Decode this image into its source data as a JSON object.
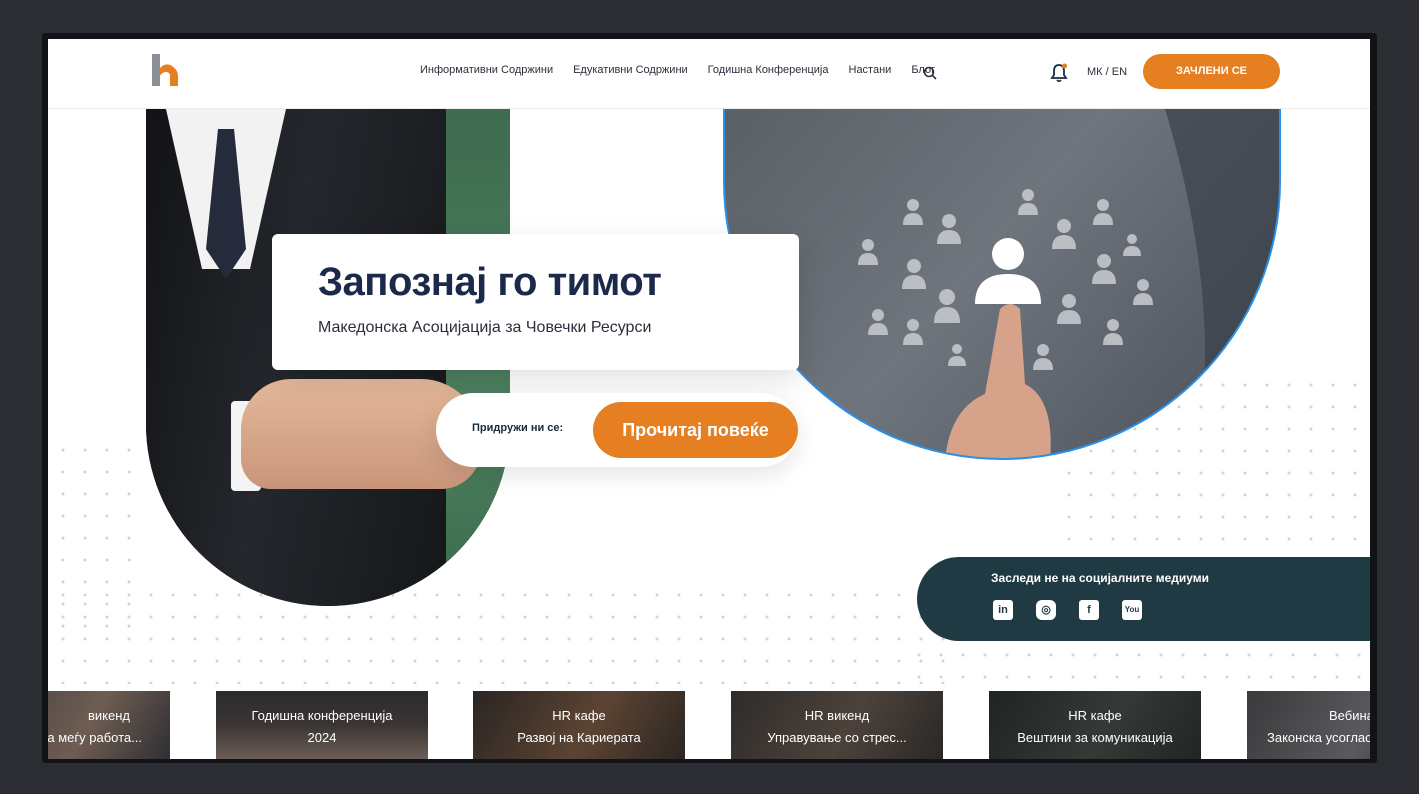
{
  "header": {
    "nav": [
      "Информативни Содржини",
      "Едукативни Содржини",
      "Годишна Конференција",
      "Настани",
      "Блог"
    ],
    "lang": "МК / EN",
    "join_label": "ЗАЧЛЕНИ СЕ"
  },
  "hero": {
    "title": "Запознај го тимот",
    "subtitle": "Македонска Асоцијација за Човечки Ресурси",
    "cta_label": "Придружи ни се:",
    "cta_button": "Прочитај повеќе"
  },
  "social": {
    "title": "Заследи не на социјалните медиуми",
    "icons": [
      "linkedin-icon",
      "instagram-icon",
      "facebook-icon",
      "youtube-icon"
    ],
    "icon_glyphs": [
      "in",
      "◎",
      "f",
      "You"
    ]
  },
  "cards": [
    {
      "line1": "викенд",
      "line2": "а меѓу работа..."
    },
    {
      "line1": "Годишна конференција",
      "line2": "2024"
    },
    {
      "line1": "HR кафе",
      "line2": "Развој на Кариерата"
    },
    {
      "line1": "HR викенд",
      "line2": "Управување со стрес..."
    },
    {
      "line1": "HR кафе",
      "line2": "Вештини за комуникација"
    },
    {
      "line1": "Вебина",
      "line2": "Законска усоглас"
    }
  ],
  "colors": {
    "accent": "#e67e22",
    "navy": "#1b2a4a",
    "social_bg": "#1f3a42",
    "highlight_border": "#2a90e8"
  }
}
